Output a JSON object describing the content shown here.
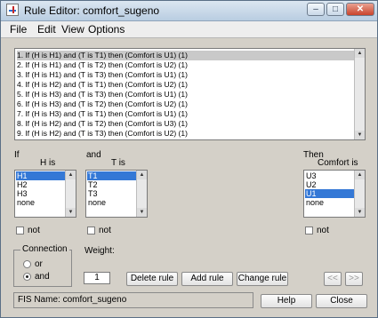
{
  "window": {
    "title": "Rule Editor: comfort_sugeno"
  },
  "menu": [
    "File",
    "Edit",
    "View",
    "Options"
  ],
  "rules": [
    "1. If (H is H1) and (T is T1) then (Comfort is U1) (1)",
    "2. If (H is H1) and (T is T2) then (Comfort is U2) (1)",
    "3. If (H is H1) and (T is T3) then (Comfort is U1) (1)",
    "4. If (H is H2) and (T is T1) then (Comfort is U2) (1)",
    "5. If (H is H3) and (T is T3) then (Comfort is U1) (1)",
    "6. If (H is H3) and (T is T2) then (Comfort is U2) (1)",
    "7. If (H is H3) and (T is T1) then (Comfort is U1) (1)",
    "8. If (H is H2) and (T is T2) then (Comfort is U3) (1)",
    "9. If (H is H2) and (T is T3) then (Comfort is U2) (1)"
  ],
  "if_section": {
    "label": "If",
    "var_label": "H is",
    "items": [
      "H1",
      "H2",
      "H3",
      "none"
    ],
    "selected": "H1",
    "not_label": "not"
  },
  "and_section": {
    "label": "and",
    "var_label": "T is",
    "items": [
      "T1",
      "T2",
      "T3",
      "none"
    ],
    "selected": "T1",
    "not_label": "not"
  },
  "then_section": {
    "label": "Then",
    "var_label": "Comfort is",
    "items": [
      "U3",
      "U2",
      "U1",
      "none"
    ],
    "selected": "U1",
    "not_label": "not"
  },
  "connection": {
    "label": "Connection",
    "options": [
      "or",
      "and"
    ],
    "selected": "and"
  },
  "weight": {
    "label": "Weight:",
    "value": "1"
  },
  "buttons": {
    "delete": "Delete rule",
    "add": "Add rule",
    "change": "Change rule",
    "prev": "<<",
    "next": ">>",
    "help": "Help",
    "close": "Close"
  },
  "status": "FIS Name: comfort_sugeno",
  "colors": {
    "selection": "#3478d6",
    "window_bg": "#d4d0c8",
    "title_gradient_top": "#dbe6f1"
  }
}
